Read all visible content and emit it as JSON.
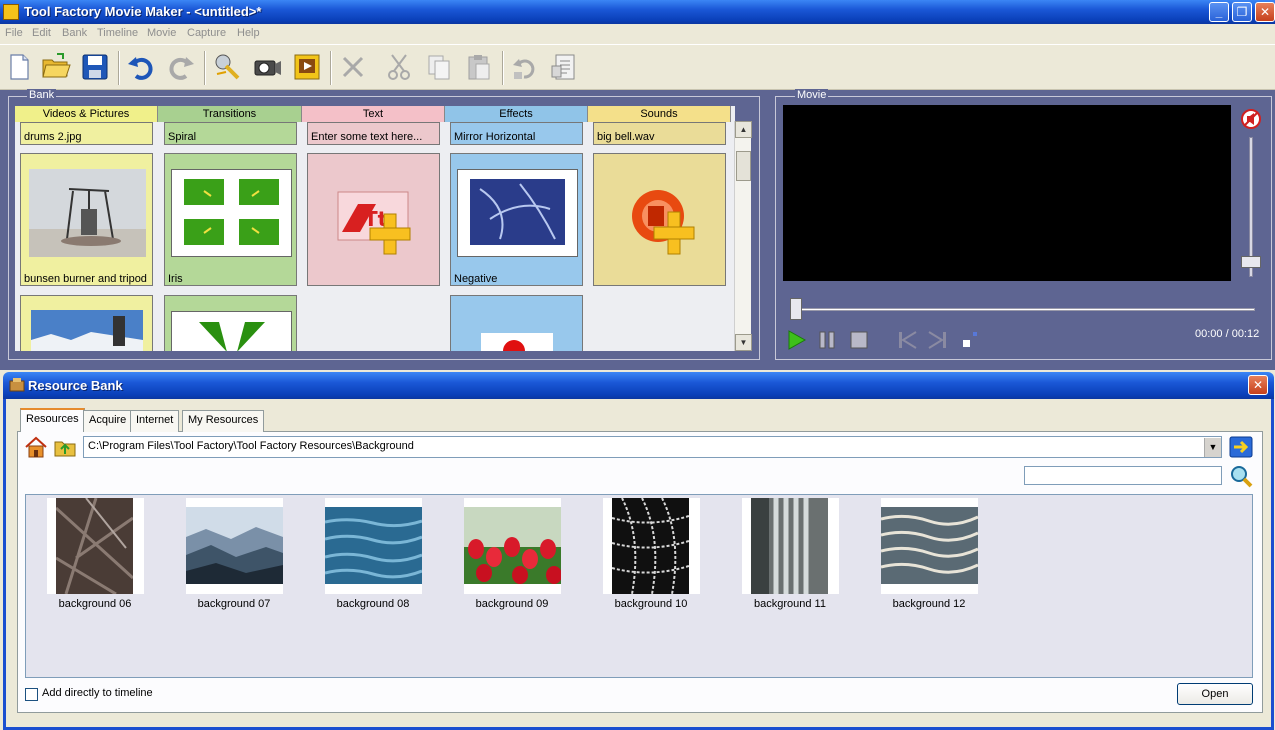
{
  "window": {
    "title": "Tool Factory Movie Maker - <untitled>*"
  },
  "menu": [
    "File",
    "Edit",
    "Bank",
    "Timeline",
    "Movie",
    "Capture",
    "Help"
  ],
  "toolbar": {
    "icons": [
      "new-document-icon",
      "open-folder-icon",
      "save-icon",
      "undo-icon",
      "redo-icon",
      "wizard-icon",
      "camera-icon",
      "slideshow-icon",
      "delete-icon",
      "cut-icon",
      "copy-icon",
      "paste-icon",
      "undo-edit-icon",
      "properties-icon"
    ]
  },
  "bank": {
    "label": "Bank",
    "columns": [
      {
        "header": "Videos & Pictures",
        "color": "#f0f08a",
        "cell_color": "#f0f0a0"
      },
      {
        "header": "Transitions",
        "color": "#a8d090",
        "cell_color": "#b4d898"
      },
      {
        "header": "Text",
        "color": "#f4c0c8",
        "cell_color": "#ecc8cc"
      },
      {
        "header": "Effects",
        "color": "#90c4e8",
        "cell_color": "#98c8ec"
      },
      {
        "header": "Sounds",
        "color": "#f4e08a",
        "cell_color": "#eadc98"
      }
    ],
    "row0": [
      "drums 2.jpg",
      "Spiral",
      "Enter some text here...",
      "Mirror Horizontal",
      "big bell.wav"
    ],
    "row1": [
      "bunsen burner and tripod",
      "Iris",
      "",
      "Negative",
      ""
    ]
  },
  "movie": {
    "label": "Movie",
    "time": "00:00 / 00:12"
  },
  "resource_bank": {
    "title": "Resource Bank",
    "tabs": [
      "Resources",
      "Acquire",
      "Internet",
      "My Resources"
    ],
    "path": "C:\\Program Files\\Tool Factory\\Tool Factory Resources\\Background",
    "search_value": "",
    "items": [
      {
        "label": "background 06",
        "kind": "leaf"
      },
      {
        "label": "background 07",
        "kind": "mountains"
      },
      {
        "label": "background 08",
        "kind": "water"
      },
      {
        "label": "background 09",
        "kind": "tulips"
      },
      {
        "label": "background 10",
        "kind": "web"
      },
      {
        "label": "background 11",
        "kind": "waterfall"
      },
      {
        "label": "background 12",
        "kind": "ripples"
      }
    ],
    "add_to_timeline_label": "Add directly to timeline",
    "add_to_timeline_checked": false,
    "open_label": "Open"
  }
}
